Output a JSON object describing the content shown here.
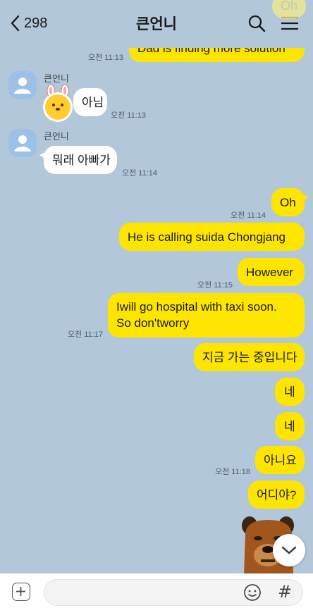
{
  "header": {
    "back_count": "298",
    "title": "큰언니",
    "partial_top_bubble": "Oh"
  },
  "messages": {
    "m0": {
      "text": "Dad is finding more solution",
      "time": "오전 11:13"
    },
    "m1": {
      "sender": "큰언니",
      "text": "아님",
      "time": "오전 11:13"
    },
    "m2": {
      "sender": "큰언니",
      "text": "뭐래 아빠가",
      "time": "오전 11:14"
    },
    "m3": {
      "text": "Oh",
      "time": "오전 11:14"
    },
    "m4": {
      "text": "He is calling suida Chongjang"
    },
    "m5": {
      "text": "However",
      "time": "오전 11:15"
    },
    "m6": {
      "line1": "Iwill go hospital  with taxi soon.",
      "line2": "So don'tworry",
      "time": "오전 11:17"
    },
    "m7": {
      "text": "지금 가는 중입니다"
    },
    "m8": {
      "text": "네"
    },
    "m9": {
      "text": "네"
    },
    "m10": {
      "text": "아니요",
      "time": "오전 11:18"
    },
    "m11": {
      "text": "어디야?"
    }
  },
  "input": {
    "placeholder": "",
    "hash_label": "#"
  },
  "colors": {
    "chat_bg": "#b2c7d9",
    "my_bubble": "#fee500",
    "their_bubble": "#ffffff"
  },
  "icons": [
    "chevron-left-icon",
    "search-icon",
    "menu-icon",
    "user-placeholder-icon",
    "chevron-down-icon",
    "plus-icon",
    "emoji-icon"
  ]
}
